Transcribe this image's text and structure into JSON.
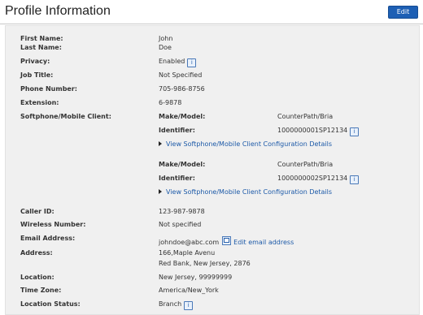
{
  "header": {
    "title": "Profile Information",
    "edit_label": "Edit"
  },
  "profile": {
    "first_name_label": "First Name:",
    "first_name": "John",
    "last_name_label": "Last Name:",
    "last_name": "Doe",
    "privacy_label": "Privacy:",
    "privacy": "Enabled",
    "job_title_label": "Job Title:",
    "job_title": "Not Specified",
    "phone_label": "Phone Number:",
    "phone": "705-986-8756",
    "extension_label": "Extension:",
    "extension": "6-9878",
    "softphone_label": "Softphone/Mobile Client:",
    "clients": [
      {
        "make_label": "Make/Model:",
        "make": "CounterPath/Bria",
        "identifier_label": "Identifier:",
        "identifier": "1000000001SP12134",
        "details_link": "View Softphone/Mobile Client Configuration Details"
      },
      {
        "make_label": "Make/Model:",
        "make": "CounterPath/Bria",
        "identifier_label": "Identifier:",
        "identifier": "1000000002SP12134",
        "details_link": "View Softphone/Mobile Client Configuration Details"
      }
    ],
    "caller_id_label": "Caller ID:",
    "caller_id": "123-987-9878",
    "wireless_label": "Wireless Number:",
    "wireless": "Not specified",
    "email_label": "Email Address:",
    "email": "johndoe@abc.com",
    "edit_email_link": "Edit email address",
    "address_label": "Address:",
    "address_line1": "166,Maple Avenu",
    "address_line2": "Red Bank, New Jersey, 2876",
    "location_label": "Location:",
    "location": "New Jersey, 99999999",
    "timezone_label": "Time Zone:",
    "timezone": "America/New_York",
    "location_status_label": "Location Status:",
    "location_status": "Branch"
  },
  "icons": {
    "info": "info-icon",
    "email": "email-icon",
    "expand": "triangle-right-icon"
  },
  "colors": {
    "accent": "#1d5fb4",
    "link": "#1d5aa8",
    "panel": "#f0f0f0"
  }
}
